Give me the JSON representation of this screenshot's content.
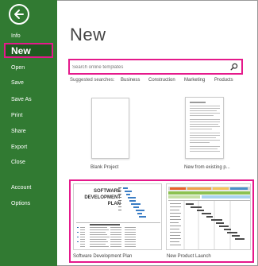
{
  "sidebar": {
    "items": [
      {
        "label": "Info"
      },
      {
        "label": "New"
      },
      {
        "label": "Open"
      },
      {
        "label": "Save"
      },
      {
        "label": "Save As"
      },
      {
        "label": "Print"
      },
      {
        "label": "Share"
      },
      {
        "label": "Export"
      },
      {
        "label": "Close"
      },
      {
        "label": "Account"
      },
      {
        "label": "Options"
      }
    ]
  },
  "main": {
    "title": "New",
    "search": {
      "placeholder": "Search online templates"
    },
    "suggested": {
      "label": "Suggested searches:",
      "links": [
        "Business",
        "Construction",
        "Marketing",
        "Products"
      ]
    },
    "templates": [
      {
        "label": "Blank Project"
      },
      {
        "label": "New from existing p..."
      },
      {
        "label": "Software Development Plan",
        "thumb_title": [
          "SOFTWARE",
          "DEVELOPMENT",
          "PLAN"
        ]
      },
      {
        "label": "New Product Launch"
      }
    ]
  },
  "colors": {
    "sidebar": "#317a32",
    "sidebar_selected": "#1f5a21",
    "highlight": "#e5198b"
  },
  "icons": {
    "back": "back-arrow-icon",
    "search": "search-icon"
  }
}
